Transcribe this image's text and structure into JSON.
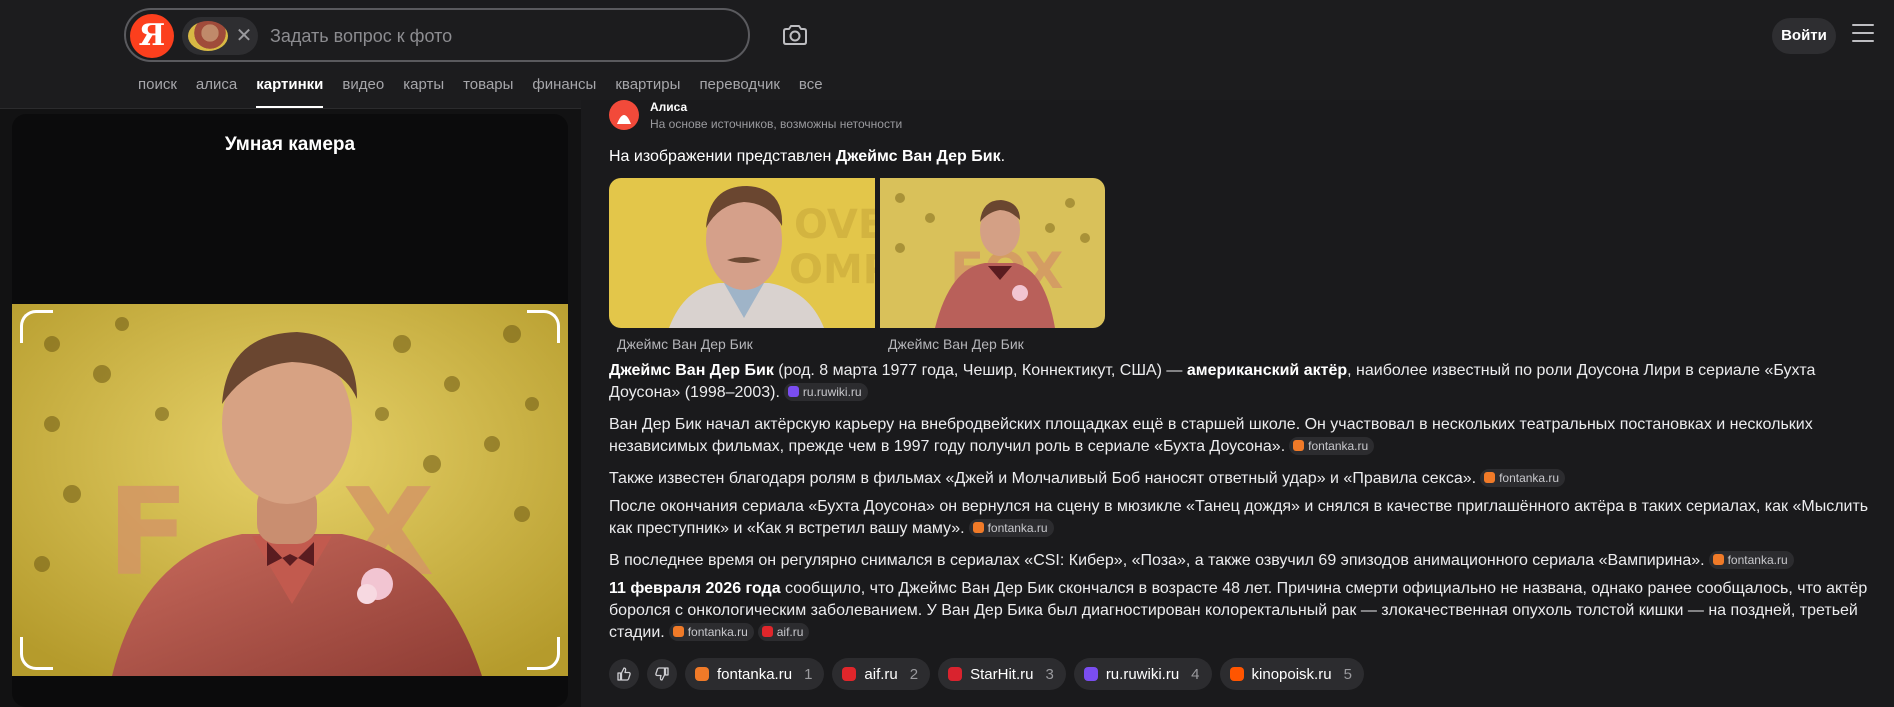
{
  "header": {
    "logo_letter": "Я",
    "search_placeholder": "Задать вопрос к фото",
    "login_label": "Войти",
    "nav": [
      "поиск",
      "алиса",
      "картинки",
      "видео",
      "карты",
      "товары",
      "финансы",
      "квартиры",
      "переводчик",
      "все"
    ],
    "active_nav": "картинки"
  },
  "left_panel": {
    "title": "Умная камера"
  },
  "answer": {
    "assistant_name": "Алиса",
    "assistant_note": "На основе источников, возможны неточности",
    "lead_prefix": "На изображении представлен ",
    "lead_name": "Джеймс Ван Дер Бик",
    "lead_suffix": ".",
    "image_captions": [
      "Джеймс Ван Дер Бик",
      "Джеймс Ван Дер Бик"
    ],
    "p1_bold1": "Джеймс Ван Дер Бик",
    "p1_text1": " (род. 8 марта 1977 года, Чешир, Коннектикут, США) — ",
    "p1_bold2": "американский актёр",
    "p1_text2": ", наиболее известный по роли Доусона Лири в сериале «Бухта Доусона» (1998–2003).",
    "p2": "Ван Дер Бик начал актёрскую карьеру на внебродвейских площадках ещё в старшей школе. Он участвовал в нескольких театральных постановках и нескольких независимых фильмах, прежде чем в 1997 году получил роль в сериале «Бухта Доусона».",
    "p3": "Также известен благодаря ролям в фильмах «Джей и Молчаливый Боб наносят ответный удар» и «Правила секса».",
    "p4": "После окончания сериала «Бухта Доусона» он вернулся на сцену в мюзикле «Танец дождя» и снялся в качестве приглашённого актёра в таких сериалах, как «Мыслить как преступник» и «Как я встретил вашу маму».",
    "p5": "В последнее время он регулярно снимался в сериалах «CSI: Кибер», «Поза», а также озвучил 69 эпизодов анимационного сериала «Вампирина».",
    "p6_bold": "11 февраля 2026 года",
    "p6_text": " сообщило, что Джеймс Ван Дер Бик скончался в возрасте 48 лет. Причина смерти официально не названа, однако ранее сообщалось, что актёр боролся с онкологическим заболеванием. У Ван Дер Бика был диагностирован колоректальный рак — злокачественная опухоль толстой кишки — на поздней, третьей стадии.",
    "src_ruwiki": "ru.ruwiki.ru",
    "src_fontanka": "fontanka.ru",
    "src_aif": "aif.ru"
  },
  "sources": [
    {
      "name": "fontanka.ru",
      "num": "1",
      "color": "#f07a28"
    },
    {
      "name": "aif.ru",
      "num": "2",
      "color": "#e0262b"
    },
    {
      "name": "StarHit.ru",
      "num": "3",
      "color": "#d9232e"
    },
    {
      "name": "ru.ruwiki.ru",
      "num": "4",
      "color": "#7a4df0"
    },
    {
      "name": "kinopoisk.ru",
      "num": "5",
      "color": "#ff5500"
    }
  ]
}
